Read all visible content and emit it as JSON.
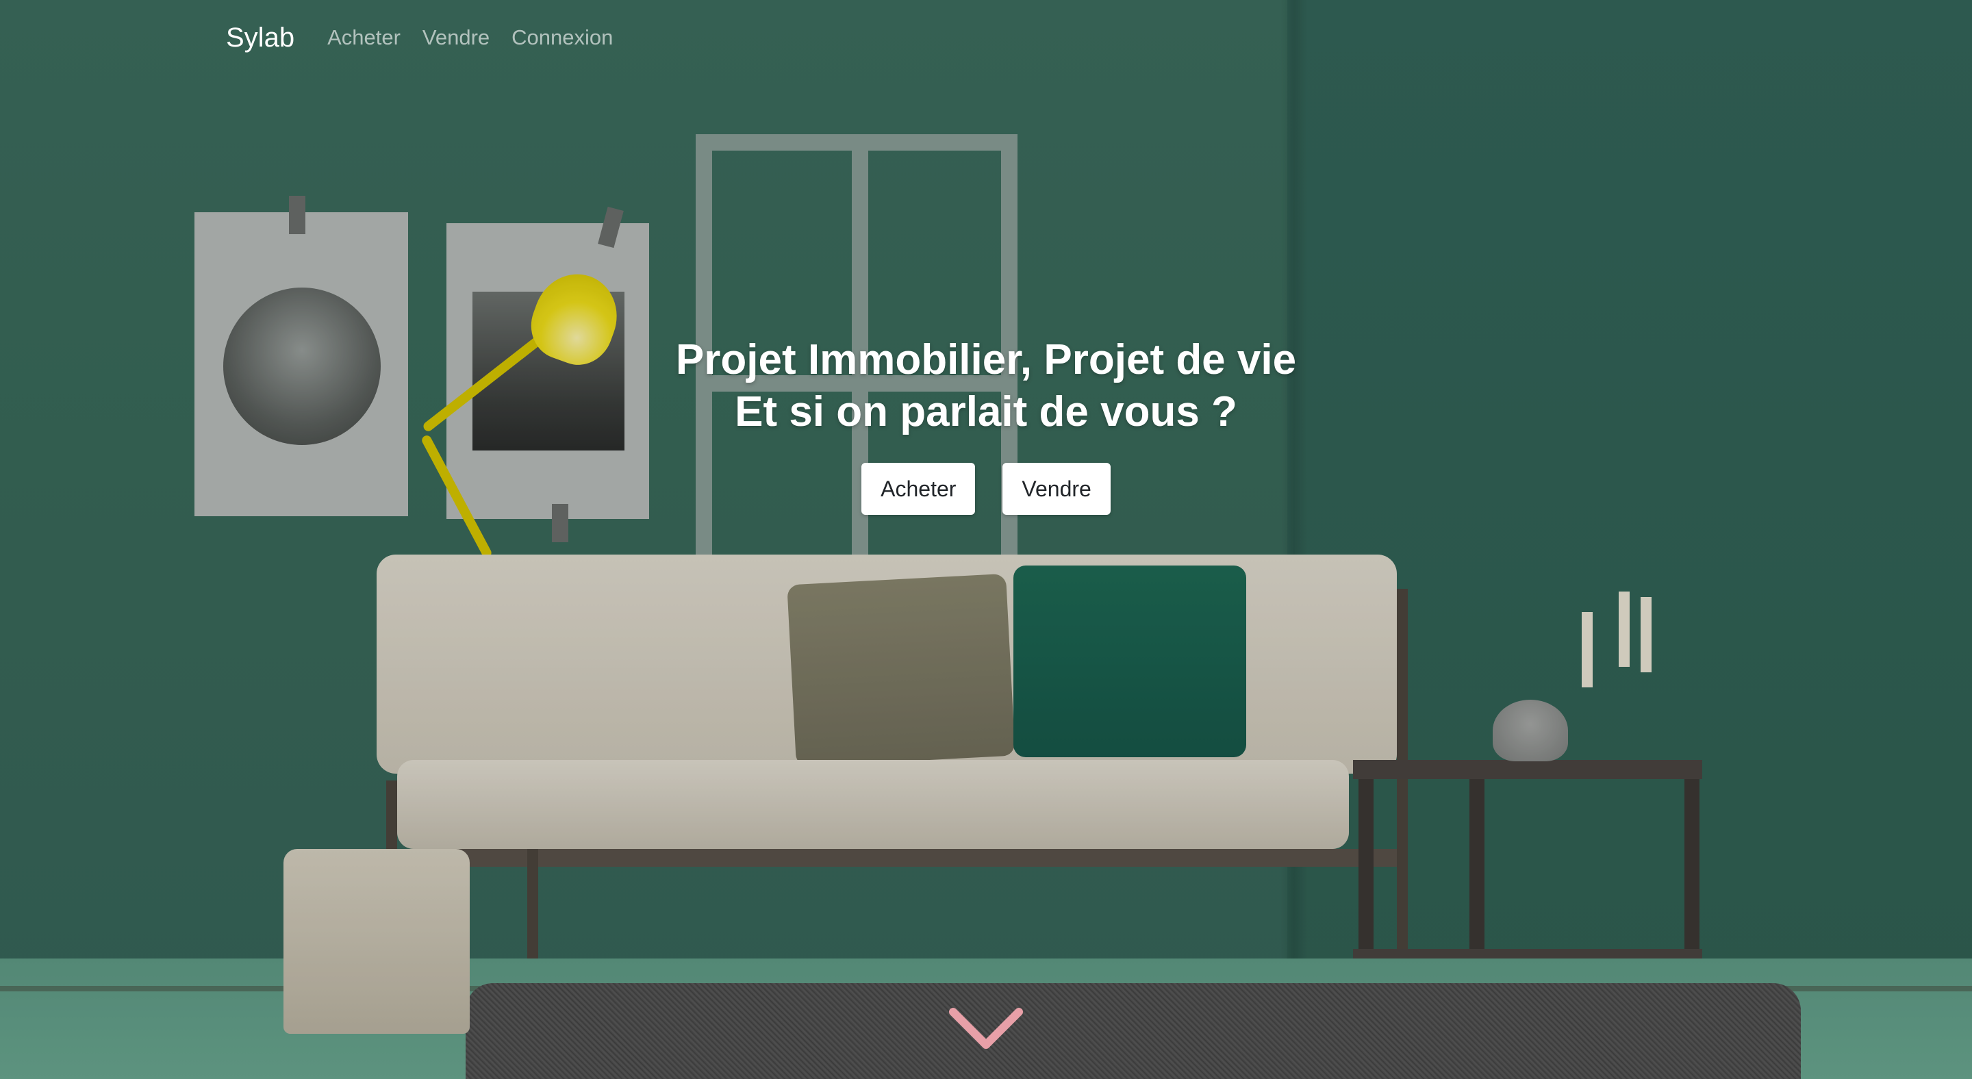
{
  "navbar": {
    "brand": "Sylab",
    "links": [
      "Acheter",
      "Vendre",
      "Connexion"
    ]
  },
  "hero": {
    "line1": "Projet Immobilier, Projet de vie",
    "line2": "Et si on parlait de vous ?",
    "buttons": {
      "buy": "Acheter",
      "sell": "Vendre"
    }
  },
  "icons": {
    "scroll": "chevron-down-icon"
  },
  "colors": {
    "wall": "#3a6a5b",
    "chevron": "#e8a0a8",
    "button_bg": "#ffffff",
    "button_text": "#212529"
  }
}
